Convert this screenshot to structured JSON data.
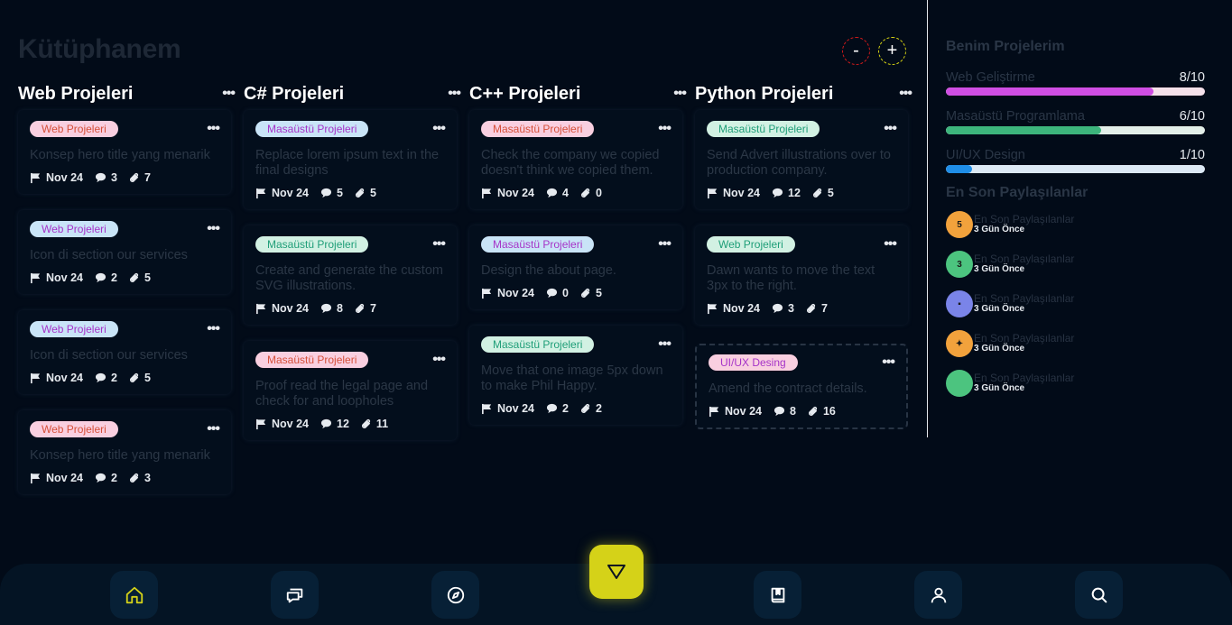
{
  "page_title": "Kütüphanem",
  "zoom": {
    "minus": "-",
    "plus": "+"
  },
  "columns": [
    {
      "title": "Web Projeleri",
      "cards": [
        {
          "tag": "Web Projeleri",
          "tag_color": "#f9cfe0",
          "tag_text_color": "#d6503a",
          "text": "Konsep hero title yang menarik",
          "date": "Nov 24",
          "comments": "3",
          "attachments": "7"
        },
        {
          "tag": "Web Projeleri",
          "tag_color": "#c9e4f7",
          "tag_text_color": "#a633c8",
          "text": "Icon di section our services",
          "date": "Nov 24",
          "comments": "2",
          "attachments": "5"
        },
        {
          "tag": "Web Projeleri",
          "tag_color": "#c9e4f7",
          "tag_text_color": "#a633c8",
          "text": "Icon di section our services",
          "date": "Nov 24",
          "comments": "2",
          "attachments": "5"
        },
        {
          "tag": "Web Projeleri",
          "tag_color": "#f9cfe0",
          "tag_text_color": "#d6503a",
          "text": "Konsep hero title yang menarik",
          "date": "Nov 24",
          "comments": "2",
          "attachments": "3"
        }
      ]
    },
    {
      "title": "C# Projeleri",
      "cards": [
        {
          "tag": "Masaüstü Projeleri",
          "tag_color": "#c9e4f7",
          "tag_text_color": "#a633c8",
          "text": "Replace lorem ipsum text in the final designs",
          "date": "Nov 24",
          "comments": "5",
          "attachments": "5"
        },
        {
          "tag": "Masaüstü Projeleri",
          "tag_color": "#d2f1e3",
          "tag_text_color": "#1f9e78",
          "text": "Create and generate the custom SVG illustrations.",
          "date": "Nov 24",
          "comments": "8",
          "attachments": "7"
        },
        {
          "tag": "Masaüstü Projeleri",
          "tag_color": "#f9cfe0",
          "tag_text_color": "#d6503a",
          "text": "Proof read the legal page and check for and loopholes",
          "date": "Nov 24",
          "comments": "12",
          "attachments": "11"
        }
      ]
    },
    {
      "title": "C++ Projeleri",
      "cards": [
        {
          "tag": "Masaüstü Projeleri",
          "tag_color": "#f9cfe0",
          "tag_text_color": "#d6503a",
          "text": "Check the company we copied doesn't think we copied them.",
          "date": "Nov 24",
          "comments": "4",
          "attachments": "0"
        },
        {
          "tag": "Masaüstü Projeleri",
          "tag_color": "#c9e4f7",
          "tag_text_color": "#a633c8",
          "text": "Design the about page.",
          "date": "Nov 24",
          "comments": "0",
          "attachments": "5"
        },
        {
          "tag": "Masaüstü Projeleri",
          "tag_color": "#d2f1e3",
          "tag_text_color": "#1f9e78",
          "text": "Move that one image 5px down to make Phil Happy.",
          "date": "Nov 24",
          "comments": "2",
          "attachments": "2"
        }
      ]
    },
    {
      "title": "Python Projeleri",
      "cards": [
        {
          "tag": "Masaüstü Projeleri",
          "tag_color": "#d2f1e3",
          "tag_text_color": "#1f9e78",
          "text": "Send Advert illustrations over to production company.",
          "date": "Nov 24",
          "comments": "12",
          "attachments": "5"
        },
        {
          "tag": "Web Projeleri",
          "tag_color": "#d2f1e3",
          "tag_text_color": "#1f9e78",
          "text": "Dawn wants to move the text 3px to the right.",
          "date": "Nov 24",
          "comments": "3",
          "attachments": "7"
        },
        {
          "tag": "UI/UX Desing",
          "tag_color": "#f9cfe0",
          "tag_text_color": "#a633c8",
          "text": "Amend the contract details.",
          "date": "Nov 24",
          "comments": "8",
          "attachments": "16"
        }
      ]
    }
  ],
  "sidebar": {
    "projects_title": "Benim Projelerim",
    "projects": [
      {
        "name": "Web Geliştirme",
        "value": "8/10",
        "fraction": 0.8,
        "color": "#d04ee3",
        "track": "#f5e1ea"
      },
      {
        "name": "Masaüstü Programlama",
        "value": "6/10",
        "fraction": 0.6,
        "color": "#3db57c",
        "track": "#e3efe9"
      },
      {
        "name": "UI/UX Design",
        "value": "1/10",
        "fraction": 0.1,
        "color": "#1f8ee8",
        "track": "#dce9f5"
      }
    ],
    "shared_title": "En Son Paylaşılanlar",
    "shared": [
      {
        "title": "En Son Paylaşılanlar",
        "time": "3 Gün Önce",
        "icon": "html5-icon",
        "glyph": "5",
        "color": "#f2a23c"
      },
      {
        "title": "En Son Paylaşılanlar",
        "time": "3 Gün Önce",
        "icon": "css3-icon",
        "glyph": "3",
        "color": "#4cc47f"
      },
      {
        "title": "En Son Paylaşılanlar",
        "time": "3 Gün Önce",
        "icon": "file-icon",
        "glyph": "▪",
        "color": "#7a84e8"
      },
      {
        "title": "En Son Paylaşılanlar",
        "time": "3 Gün Önce",
        "icon": "python-icon",
        "glyph": "✦",
        "color": "#f2a23c"
      },
      {
        "title": "En Son Paylaşılanlar",
        "time": "3 Gün Önce",
        "icon": "code-icon",
        "glyph": "</>",
        "color": "#4cc47f"
      }
    ]
  },
  "nav": {
    "accent": "#d5d218",
    "items": [
      "home-icon",
      "chat-icon",
      "compass-icon",
      "book-icon",
      "user-icon",
      "search-icon"
    ]
  }
}
